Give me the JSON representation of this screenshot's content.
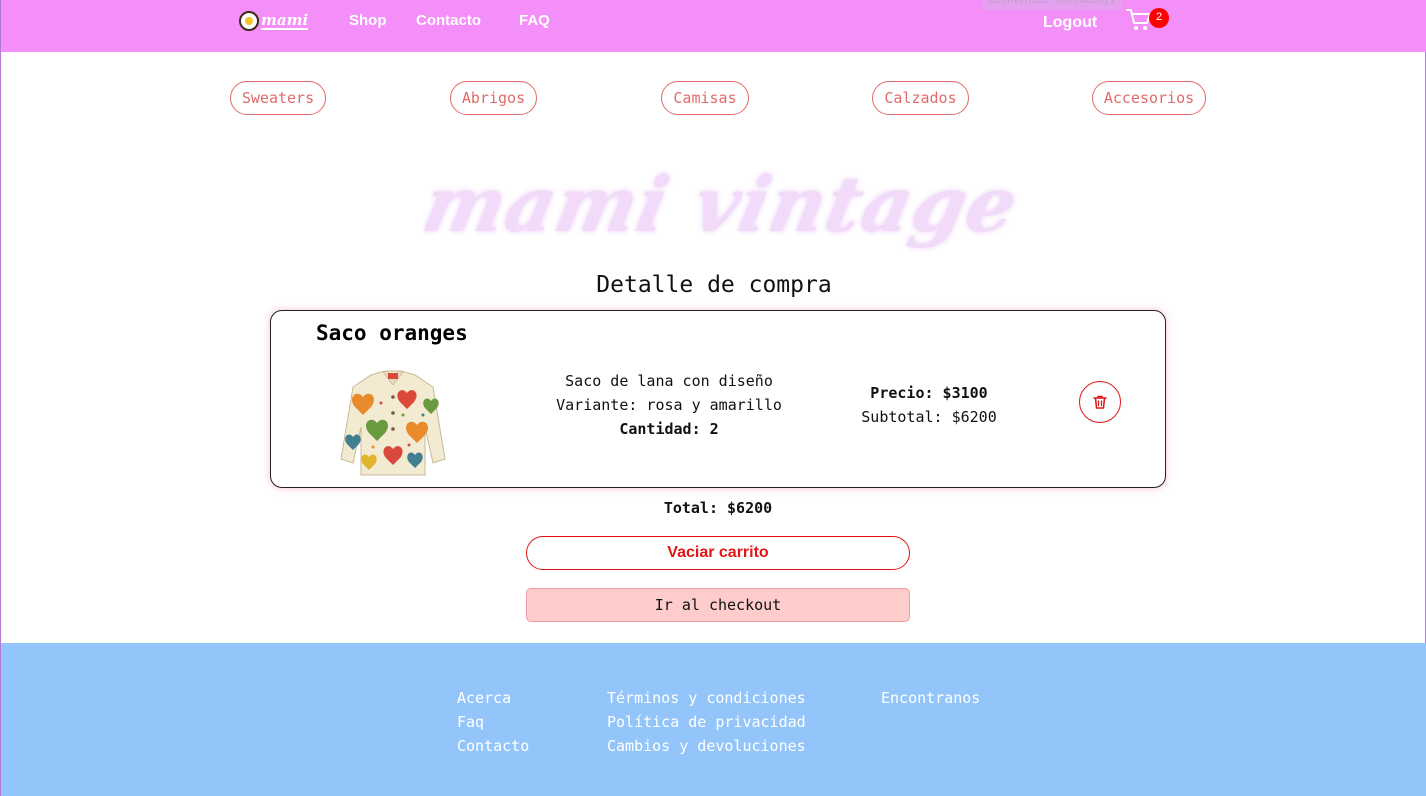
{
  "header": {
    "logo_text": "mami",
    "nav": [
      "Shop",
      "Contacto",
      "FAQ"
    ],
    "welcome": "Bienvenido shotaoduji",
    "logout": "Logout",
    "cart_count": "2"
  },
  "categories": [
    "Sweaters",
    "Abrigos",
    "Camisas",
    "Calzados",
    "Accesorios"
  ],
  "brand": "mami vintage",
  "page_title": "Detalle de compra",
  "cart_item": {
    "name": "Saco oranges",
    "description": "Saco de lana con diseño",
    "variant": "Variante: rosa y amarillo",
    "quantity": "Cantidad: 2",
    "price": "Precio: $3100",
    "subtotal": "Subtotal: $6200"
  },
  "total": "Total: $6200",
  "buttons": {
    "empty_cart": "Vaciar carrito",
    "checkout": "Ir al checkout"
  },
  "footer": {
    "col1": [
      "Acerca",
      "Faq",
      "Contacto"
    ],
    "col2": [
      "Términos y condiciones",
      "Política de privacidad",
      "Cambios y devoluciones"
    ],
    "col3": [
      "Encontranos"
    ]
  },
  "colors": {
    "navbar": "#f48ef8",
    "accent_red": "#e01515",
    "category_border": "#e26a6a",
    "footer": "#93c5fb",
    "checkout_bg": "#ffcccc"
  }
}
